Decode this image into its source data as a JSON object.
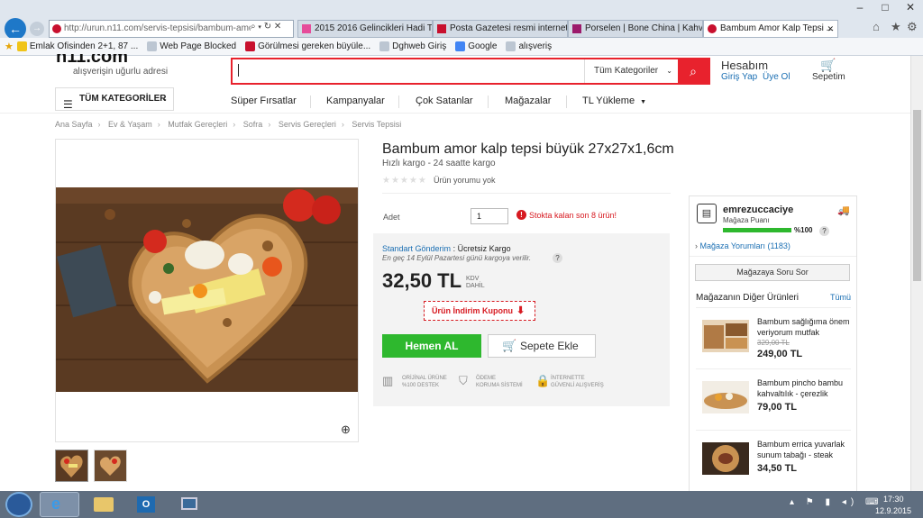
{
  "browser": {
    "address": "http://urun.n11.com/servis-tepsisi/bambum-amor",
    "address_domain": "n11.com",
    "tabs": [
      {
        "label": "2015 2016 Gelincikleri Hadi To..."
      },
      {
        "label": "Posta Gazetesi resmi internet si..."
      },
      {
        "label": "Porselen | Bone China | Kahvalt..."
      },
      {
        "label": "Bambum Amor Kalp Tepsi ..."
      }
    ],
    "favorites": [
      {
        "label": "Emlak Ofisinden 2+1, 87 ..."
      },
      {
        "label": "Web Page Blocked"
      },
      {
        "label": "Görülmesi gereken büyüle..."
      },
      {
        "label": "Dghweb Giriş"
      },
      {
        "label": "Google"
      },
      {
        "label": "alışveriş"
      }
    ]
  },
  "header": {
    "logo": "n11.com",
    "slogan": "alışverişin uğurlu adresi",
    "search_category": "Tüm Kategoriler",
    "account_title": "Hesabım",
    "login": "Giriş Yap",
    "register": "Üye Ol",
    "cart": "Sepetim"
  },
  "nav": {
    "categories": "TÜM KATEGORİLER",
    "items": [
      "Süper Fırsatlar",
      "Kampanyalar",
      "Çok Satanlar",
      "Mağazalar",
      "TL Yükleme"
    ]
  },
  "breadcrumb": [
    "Ana Sayfa",
    "Ev & Yaşam",
    "Mutfak Gereçleri",
    "Sofra",
    "Servis Gereçleri",
    "Servis Tepsisi"
  ],
  "product": {
    "title": "Bambum amor kalp tepsi büyük 27x27x1,6cm",
    "shipping": "Hızlı kargo - 24 saatte kargo",
    "reviews": "Ürün yorumu yok",
    "qty_label": "Adet",
    "qty": "1",
    "stock": "Stokta kalan son 8 ürün!",
    "ship_type": "Standart Gönderim",
    "ship_cost": ": Ücretsiz Kargo",
    "ship_date": "En geç 14 Eylül Pazartesi günü kargoya verilir.",
    "price": "32,50 TL",
    "kdv": "KDV",
    "kdv2": "DAHİL",
    "coupon": "Ürün İndirim Kuponu",
    "buy_now": "Hemen AL",
    "add_cart": "Sepete Ekle",
    "badges": [
      {
        "l1": "ORİJİNAL ÜRÜNE",
        "l2": "%100 DESTEK"
      },
      {
        "l1": "ÖDEME",
        "l2": "KORUMA SİSTEMİ"
      },
      {
        "l1": "İNTERNETTE",
        "l2": "GÜVENLİ ALIŞVERİŞ"
      }
    ]
  },
  "seller": {
    "name": "emrezuccaciye",
    "label": "Mağaza Puanı",
    "score": "%100",
    "score_value": 1.0,
    "reviews": "Mağaza Yorumları (1183)",
    "ask": "Mağazaya Soru Sor",
    "other_title": "Mağazanın Diğer Ürünleri",
    "other_all": "Tümü",
    "products": [
      {
        "name": "Bambum sağlığıma önem veriyorum mutfak",
        "old": "329,00 TL",
        "price": "249,00 TL"
      },
      {
        "name": "Bambum pincho bambu kahvaltılık - çerezlik",
        "old": "",
        "price": "79,00 TL"
      },
      {
        "name": "Bambum errica yuvarlak sunum tabağı - steak",
        "old": "",
        "price": "34,50 TL"
      }
    ]
  },
  "taskbar": {
    "time": "17:30",
    "date": "12.9.2015"
  },
  "colors": {
    "brand_red": "#e8222d",
    "buy_green": "#2eb82e",
    "link_blue": "#1b6fb3"
  }
}
